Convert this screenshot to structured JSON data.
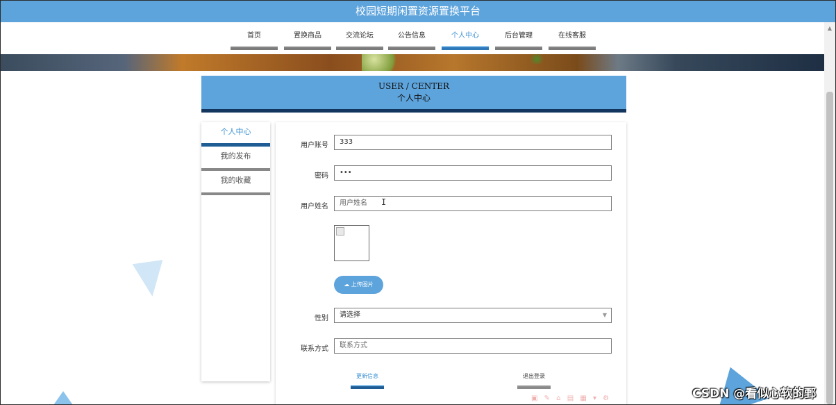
{
  "app": {
    "title": "校园短期闲置资源置换平台"
  },
  "nav": {
    "items": [
      {
        "label": "首页",
        "active": false
      },
      {
        "label": "置换商品",
        "active": false
      },
      {
        "label": "交流论坛",
        "active": false
      },
      {
        "label": "公告信息",
        "active": false
      },
      {
        "label": "个人中心",
        "active": true
      },
      {
        "label": "后台管理",
        "active": false
      },
      {
        "label": "在线客服",
        "active": false
      }
    ]
  },
  "page_header": {
    "title_en": "USER / CENTER",
    "title_cn": "个人中心"
  },
  "sidebar": {
    "items": [
      {
        "label": "个人中心",
        "active": true
      },
      {
        "label": "我的发布",
        "active": false
      },
      {
        "label": "我的收藏",
        "active": false
      }
    ]
  },
  "form": {
    "account": {
      "label": "用户账号",
      "value": "333"
    },
    "password": {
      "label": "密码",
      "value": "•••"
    },
    "name": {
      "label": "用户姓名",
      "placeholder": "用户姓名"
    },
    "upload": {
      "label": "上传图片"
    },
    "gender": {
      "label": "性别",
      "selected": "请选择"
    },
    "contact": {
      "label": "联系方式",
      "placeholder": "联系方式"
    },
    "update_button": "更新信息",
    "logout_button": "退出登录"
  },
  "watermark": "CSDN @看似心软的鄄",
  "colors": {
    "accent": "#5ea4dc",
    "dark_accent": "#13365e",
    "active_text": "#3f93d4"
  },
  "icons": {
    "upload": "cloud-upload-icon",
    "dropdown": "chevron-down-icon",
    "cursor": "text-cursor-icon"
  }
}
